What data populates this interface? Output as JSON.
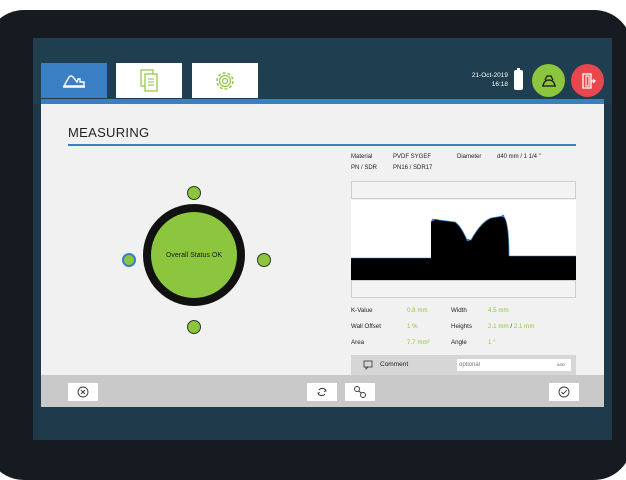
{
  "header": {
    "date": "21-Oct-2019",
    "time": "16:18",
    "colors": {
      "accent": "#3a7fc4",
      "ok": "#8cc63f",
      "exit": "#e8474e",
      "bar": "#1f3e4f"
    },
    "tabs": [
      {
        "icon": "measure-tool-icon"
      },
      {
        "icon": "documents-icon"
      },
      {
        "icon": "gear-icon"
      }
    ],
    "user_icon": "user-icon",
    "exit_icon": "exit-door-icon"
  },
  "page": {
    "title": "MEASURING"
  },
  "status": {
    "text": "Overall Status OK"
  },
  "pipe": {
    "material_label": "Material",
    "material_value": "PVDF SYGEF",
    "diameter_label": "Diameter",
    "diameter_value": "d40 mm / 1 1/4 \"",
    "pn_label": "PN / SDR",
    "pn_value": "PN16 / SDR17"
  },
  "measurements": {
    "k_value_label": "K-Value",
    "k_value": "0.8 mm",
    "width_label": "Width",
    "width_value": "4.5 mm",
    "wall_offset_label": "Wall Offset",
    "wall_offset_value": "1 %",
    "heights_label": "Heights",
    "height_1": "2.1 mm",
    "height_sep": "/",
    "height_2": "2.1 mm",
    "area_label": "Area",
    "area_value": "7.7 mm²",
    "angle_label": "Angle",
    "angle_value": "1 °"
  },
  "comment": {
    "label": "Comment",
    "placeholder": "optional",
    "counter": "0/50"
  },
  "toolbar": {
    "cancel_icon": "cancel-icon",
    "refresh_icon": "refresh-icon",
    "tools_icon": "tools-icon",
    "confirm_icon": "confirm-icon"
  }
}
